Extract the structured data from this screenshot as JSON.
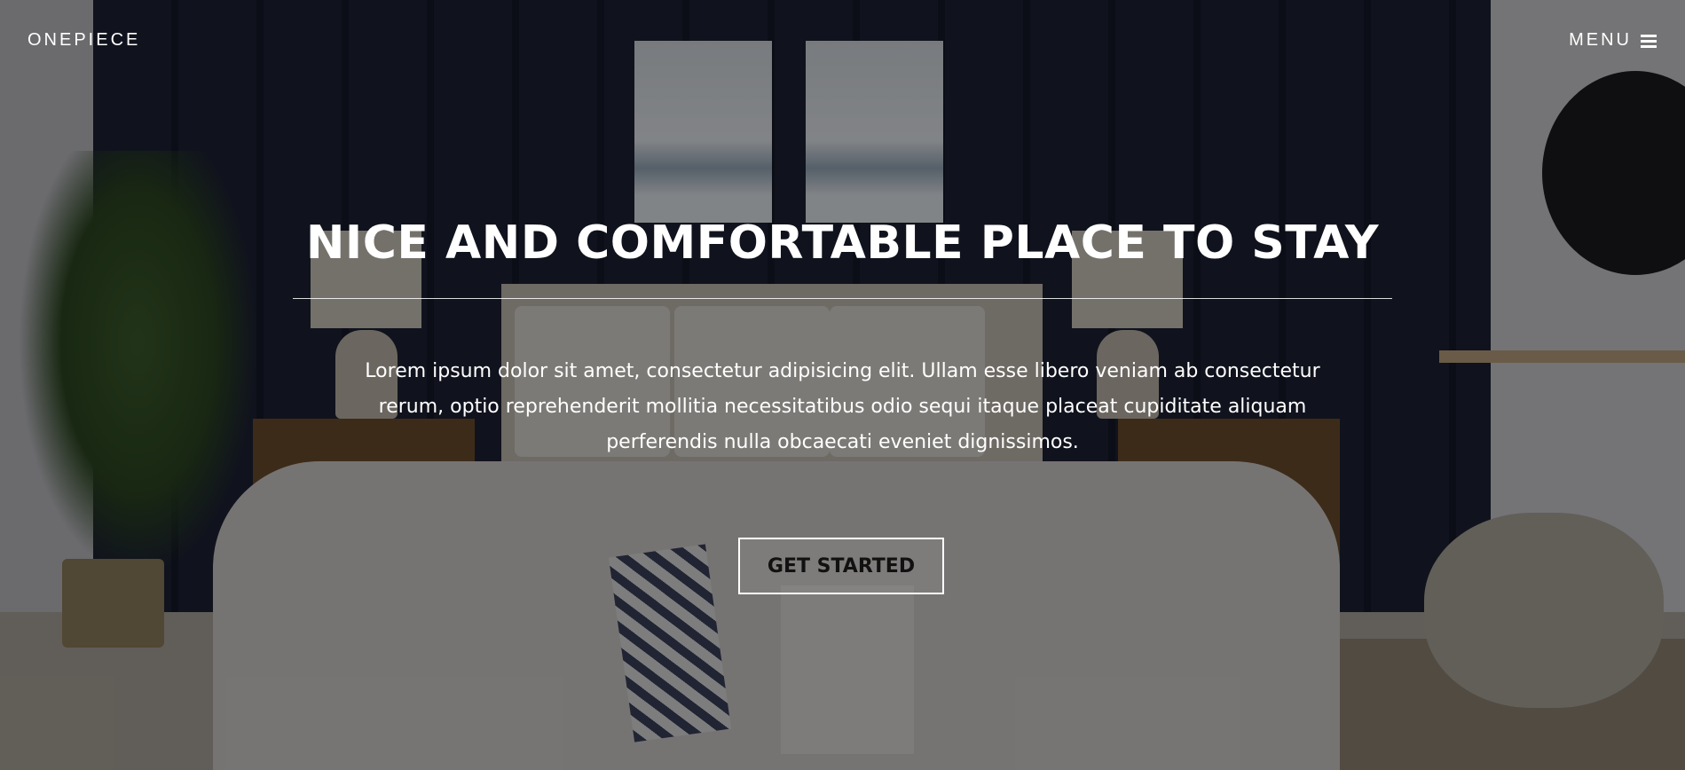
{
  "nav": {
    "brand": "ONEPIECE",
    "menu_label": "MENU",
    "menu_icon": "hamburger-icon"
  },
  "hero": {
    "title": "NICE AND COMFORTABLE PLACE TO STAY",
    "description": "Lorem ipsum dolor sit amet, consectetur adipisicing elit. Ullam esse libero veniam ab consectetur rerum, optio reprehenderit mollitia necessitatibus odio sequi itaque placeat cupiditate aliquam perferendis nulla obcaecati eveniet dignissimos.",
    "cta_label": "GET STARTED"
  },
  "colors": {
    "text": "#ffffff",
    "overlay": "#000000",
    "cta_text": "#111111"
  }
}
